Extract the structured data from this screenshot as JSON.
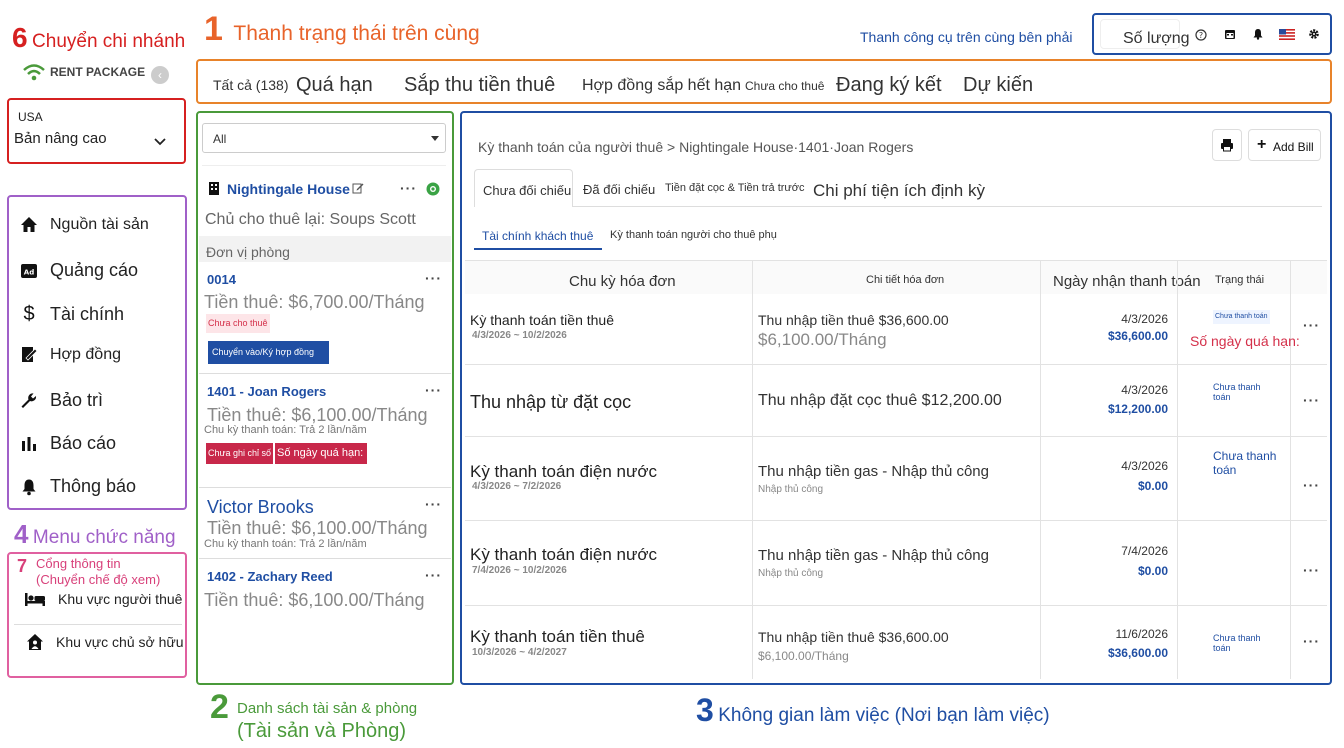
{
  "annotations": {
    "n1": "1",
    "l1": "Thanh trạng thái trên cùng",
    "n2": "2",
    "l2a": "Danh sách tài sản & phòng",
    "l2b": "(Tài sản và Phòng)",
    "n3": "3",
    "l3": "Không gian làm việc (Nơi bạn làm việc)",
    "n4": "4",
    "l4": "Menu chức năng",
    "n6": "6",
    "l6": "Chuyển chi nhánh",
    "n7": "7",
    "l7a": "Cổng thông tin",
    "l7b": "(Chuyển chế độ xem)",
    "toolbar_right": "Thanh công cụ trên cùng bên phải"
  },
  "brand": {
    "logo_text": "RENT PACKAGE",
    "accent": "#4a9a3a"
  },
  "branch": {
    "country": "USA",
    "plan": "Bản nâng cao"
  },
  "toolbar": {
    "quantity_label": "Số lượng"
  },
  "top_tabs": [
    "Tất cả (138)",
    "Quá hạn",
    "Sắp thu tiền thuê",
    "Hợp đồng sắp hết hạn",
    "Chưa cho thuê",
    "Đang ký kết",
    "Dự kiến"
  ],
  "menu": [
    "Nguồn tài sản",
    "Quảng cáo",
    "Tài chính",
    "Hợp đồng",
    "Bảo trì",
    "Báo cáo",
    "Thông báo"
  ],
  "portal": [
    "Khu vực người thuê",
    "Khu vực chủ sở hữu"
  ],
  "property_list": {
    "filter": "All",
    "property_name": "Nightingale House",
    "sublandlord": "Chủ cho thuê lại: Soups Scott",
    "section": "Đơn vị phòng",
    "units": [
      {
        "code": "0014",
        "rent": "Tiền thuê: $6,700.00/Tháng",
        "badge": "Chưa cho thuê",
        "button": "Chuyển vào/Ký hợp đồng"
      },
      {
        "code": "1401 - Joan Rogers",
        "rent": "Tiền thuê: $6,100.00/Tháng",
        "cycle": "Chu kỳ thanh toán: Trả 2 lần/năm",
        "badge1": "Chưa ghi chỉ số",
        "badge2": "Số ngày quá hạn:"
      },
      {
        "code": "Victor Brooks",
        "rent": "Tiền thuê: $6,100.00/Tháng",
        "cycle": "Chu kỳ thanh toán: Trả 2 lần/năm"
      },
      {
        "code": "1402 - Zachary Reed",
        "rent": "Tiền thuê: $6,100.00/Tháng"
      }
    ]
  },
  "workspace": {
    "breadcrumb": "Kỳ thanh toán của người thuê > Nightingale House·1401·Joan Rogers",
    "add_bill": "Add Bill",
    "tabs": [
      "Chưa đối chiếu",
      "Đã đối chiếu",
      "Tiền đặt cọc & Tiền trả trước",
      "Chi phí tiện ích định kỳ"
    ],
    "subtabs": [
      "Tài chính khách thuê",
      "Kỳ thanh toán người cho thuê phụ"
    ],
    "columns": [
      "Chu kỳ hóa đơn",
      "Chi tiết hóa đơn",
      "Ngày nhận thanh toán",
      "Trạng thái"
    ],
    "overdue_label": "Số ngày quá hạn:",
    "rows": [
      {
        "title": "Kỳ thanh toán tiền thuê",
        "period": "4/3/2026 ~ 10/2/2026",
        "detail": "Thu nhập tiền thuê $36,600.00",
        "detail_sub": "$6,100.00/Tháng",
        "date": "4/3/2026",
        "amount": "$36,600.00",
        "status": "Chưa thanh toán"
      },
      {
        "title": "Thu nhập từ đặt cọc",
        "period": "",
        "detail": "Thu nhập đặt cọc thuê $12,200.00",
        "detail_sub": "",
        "date": "4/3/2026",
        "amount": "$12,200.00",
        "status": "Chưa thanh toán"
      },
      {
        "title": "Kỳ thanh toán điện nước",
        "period": "4/3/2026 ~ 7/2/2026",
        "detail": "Thu nhập tiền gas - Nhập thủ công",
        "detail_sub": "Nhập thủ công",
        "date": "4/3/2026",
        "amount": "$0.00",
        "status": "Chưa thanh toán"
      },
      {
        "title": "Kỳ thanh toán điện nước",
        "period": "7/4/2026 ~ 10/2/2026",
        "detail": "Thu nhập tiền gas - Nhập thủ công",
        "detail_sub": "Nhập thủ công",
        "date": "7/4/2026",
        "amount": "$0.00",
        "status": ""
      },
      {
        "title": "Kỳ thanh toán tiền thuê",
        "period": "10/3/2026 ~ 4/2/2027",
        "detail": "Thu nhập tiền thuê $36,600.00",
        "detail_sub": "$6,100.00/Tháng",
        "date": "11/6/2026",
        "amount": "$36,600.00",
        "status": "Chưa thanh toán"
      }
    ]
  }
}
